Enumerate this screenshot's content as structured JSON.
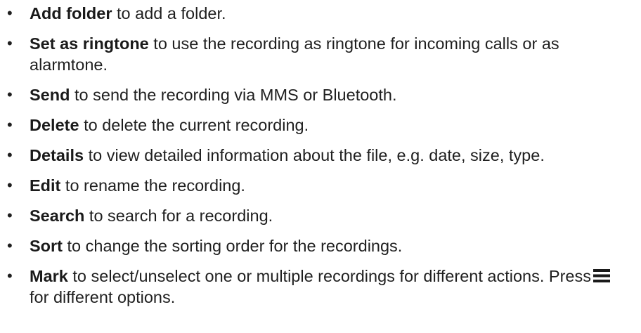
{
  "items": [
    {
      "term": "Add folder",
      "desc": " to add a folder."
    },
    {
      "term": "Set as ringtone",
      "desc": " to use the recording as ringtone for incoming calls or as alarmtone."
    },
    {
      "term": "Send",
      "desc": " to send the recording via MMS or Bluetooth."
    },
    {
      "term": "Delete",
      "desc": " to delete the current recording."
    },
    {
      "term": "Details",
      "desc": " to view detailed information about the file, e.g. date, size, type."
    },
    {
      "term": "Edit",
      "desc": " to rename the recording."
    },
    {
      "term": "Search",
      "desc": " to search for a recording."
    },
    {
      "term": "Sort",
      "desc": " to change the sorting order for the recordings."
    },
    {
      "term": "Mark",
      "desc": " to select/unselect one or multiple recordings for different actions. Press",
      "desc_after_icon": " for different options.",
      "icon": "menu-icon"
    }
  ],
  "bullet": "•",
  "colors": {
    "text": "#1f1f1f",
    "background": "#ffffff"
  }
}
